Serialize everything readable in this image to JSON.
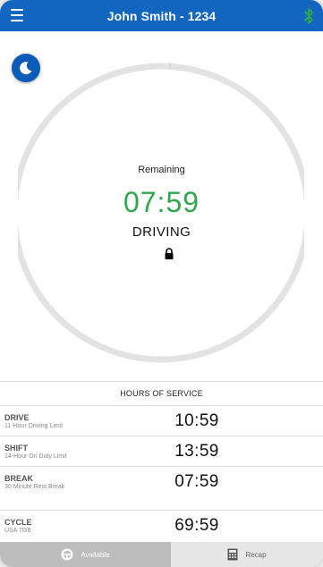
{
  "header": {
    "title": "John Smith - 1234",
    "bluetooth_color": "#2ea84a",
    "bar_color": "#1266bf"
  },
  "gauge": {
    "label": "Remaining",
    "time": "07:59",
    "status": "DRIVING",
    "time_color": "#2ea84a",
    "progress_fraction": 0.0
  },
  "hos": {
    "title": "HOURS OF SERVICE",
    "rows": [
      {
        "name": "DRIVE",
        "desc": "11-Hour Driving Limit",
        "value": "10:59"
      },
      {
        "name": "SHIFT",
        "desc": "14-Hour On Duty Limit",
        "value": "13:59"
      },
      {
        "name": "BREAK",
        "desc": "30 Minute Rest Break",
        "value": "07:59"
      },
      {
        "name": "CYCLE",
        "desc": "USA 70/8",
        "value": "69:59"
      }
    ]
  },
  "bottom_nav": {
    "available_label": "Available",
    "recap_label": "Recap"
  },
  "icons": {
    "menu": "menu-icon",
    "bluetooth": "bluetooth-icon",
    "night_mode": "moon-icon",
    "lock": "lock-icon",
    "available": "steering-wheel-icon",
    "recap": "calculator-icon"
  }
}
